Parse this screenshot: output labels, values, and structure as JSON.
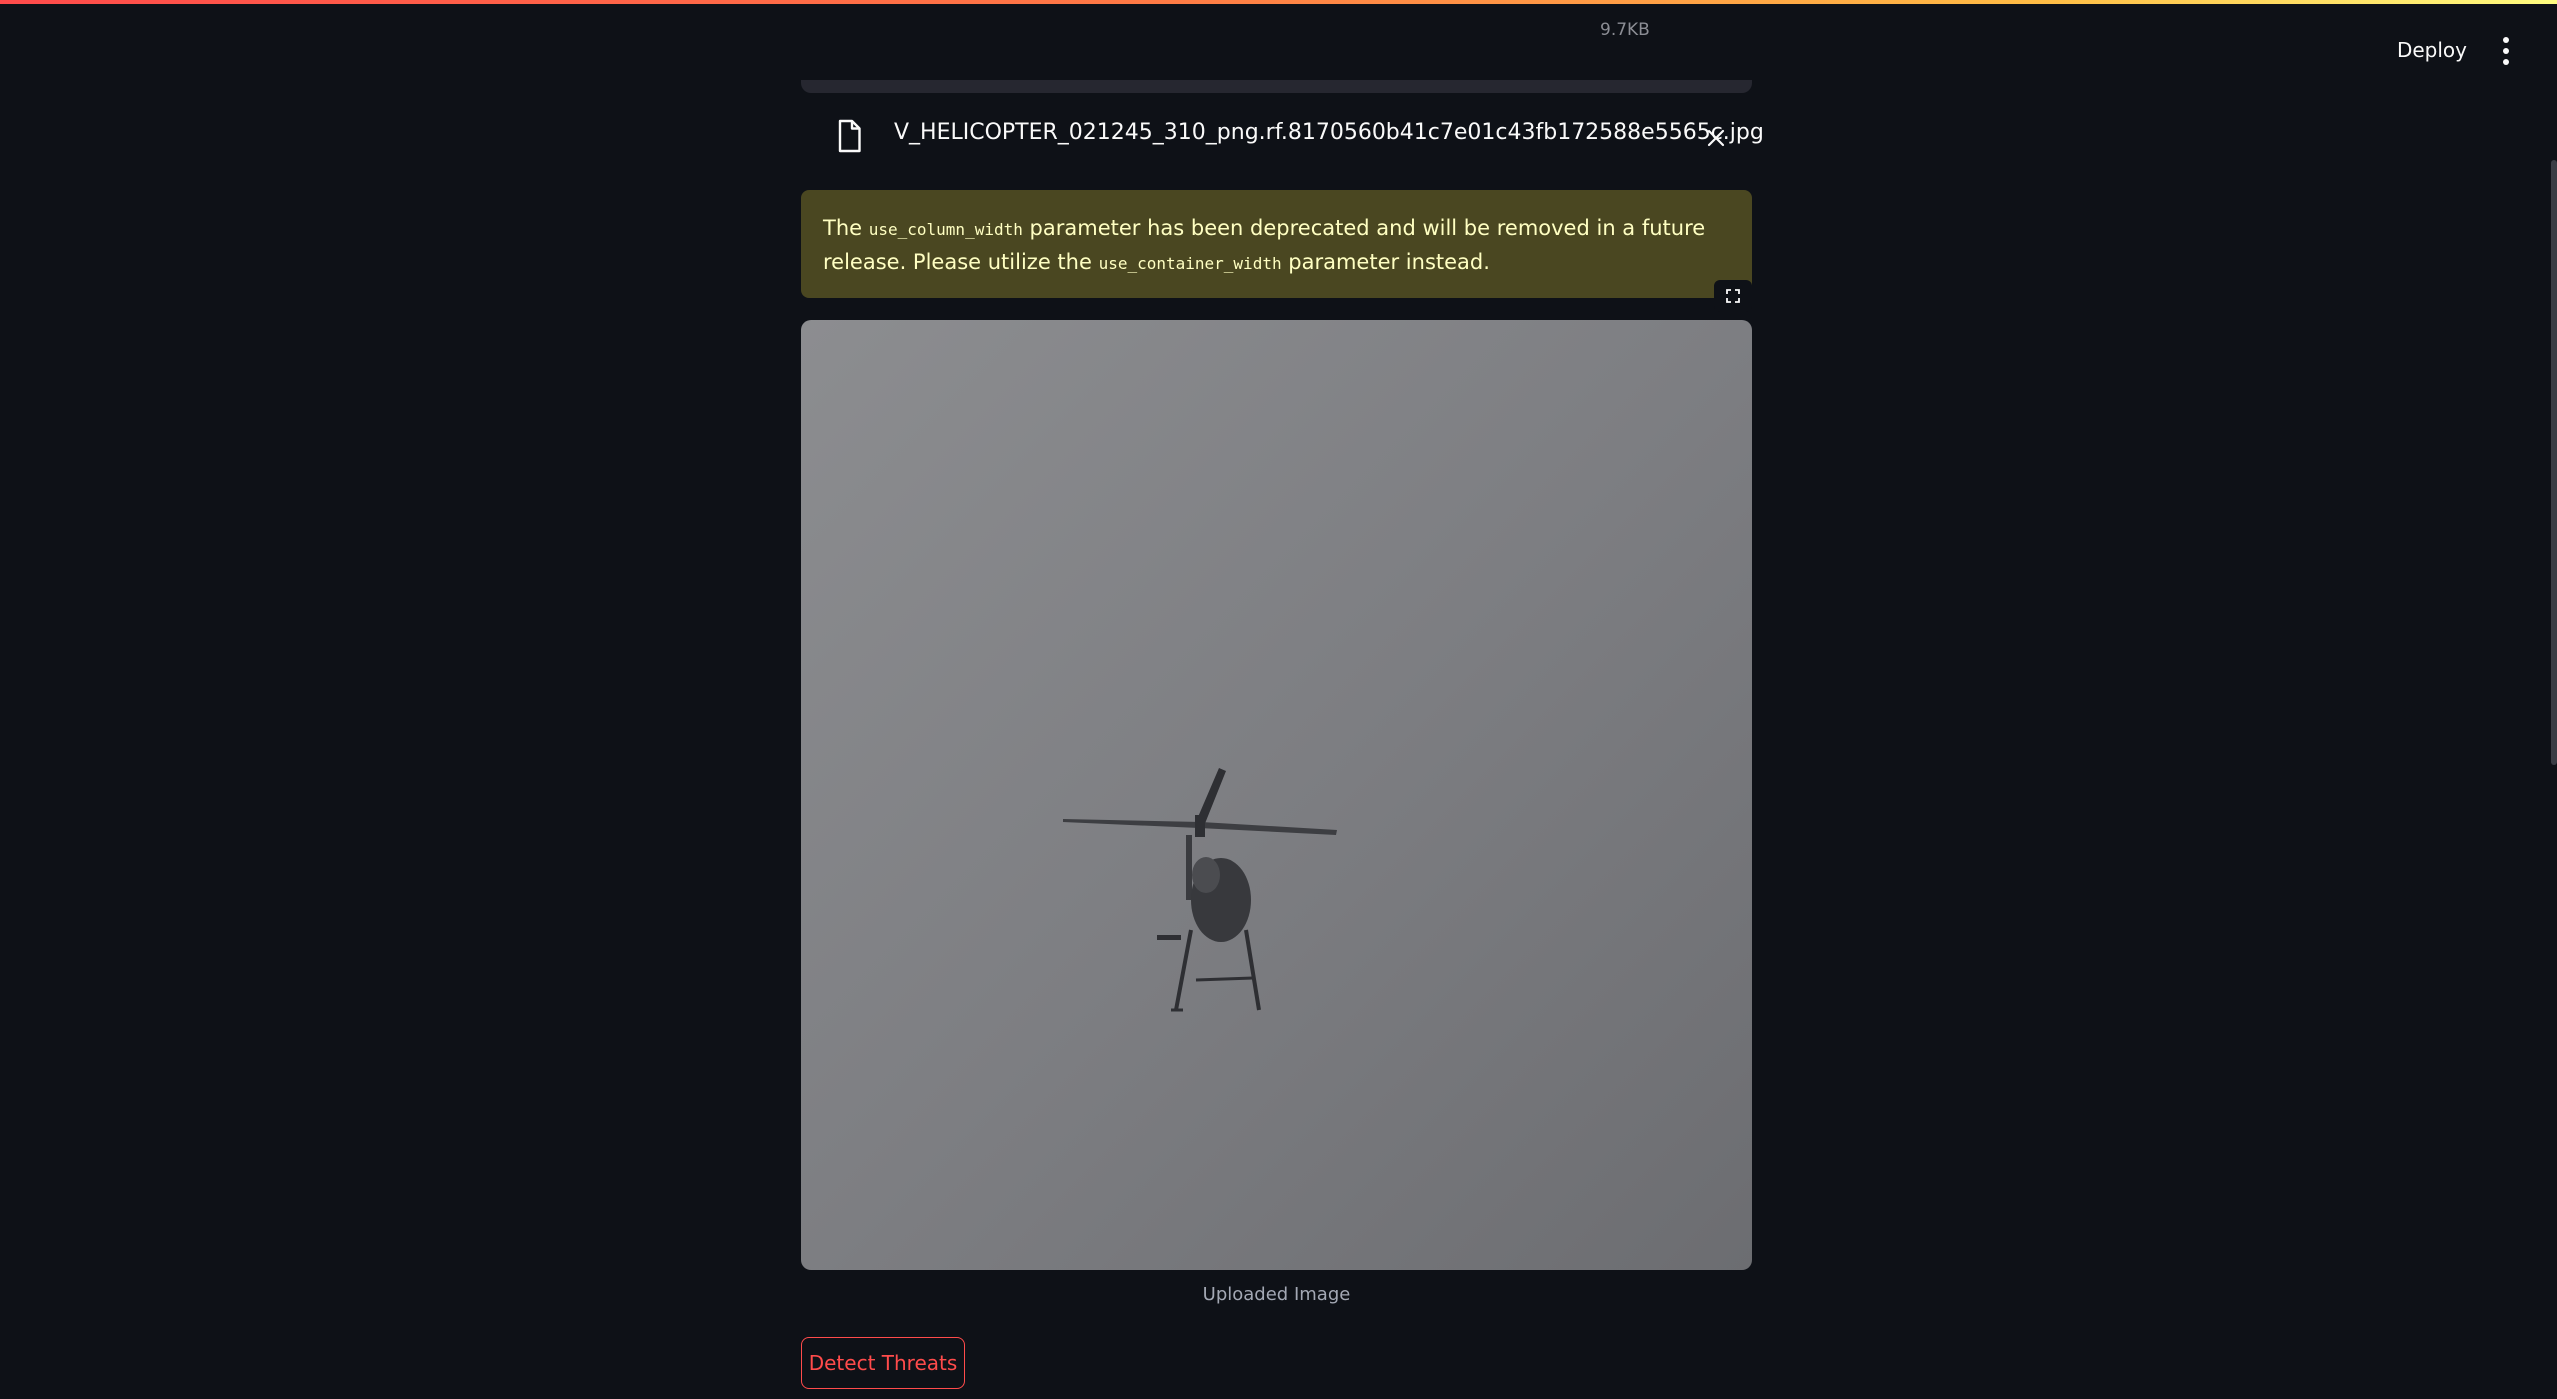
{
  "header": {
    "deploy_label": "Deploy",
    "menu_icon": "vertical-ellipsis-icon"
  },
  "uploader": {
    "file_name": "V_HELICOPTER_021245_310_png.rf.8170560b41c7e01c43fb172588e5565c.jpg",
    "file_size": "9.7KB",
    "file_icon": "file-icon",
    "remove_icon": "close-icon"
  },
  "warning": {
    "text_1": "The ",
    "code_1": "use_column_width",
    "text_2": " parameter has been deprecated and will be removed in a future release. Please utilize the ",
    "code_2": "use_container_width",
    "text_3": " parameter instead."
  },
  "image": {
    "caption": "Uploaded Image",
    "fullscreen_icon": "fullscreen-icon"
  },
  "actions": {
    "detect_label": "Detect Threats"
  },
  "colors": {
    "background": "#0e1117",
    "warning_bg": "#4a4721",
    "warning_text": "#ffffc2",
    "accent": "#ff4b4b"
  }
}
